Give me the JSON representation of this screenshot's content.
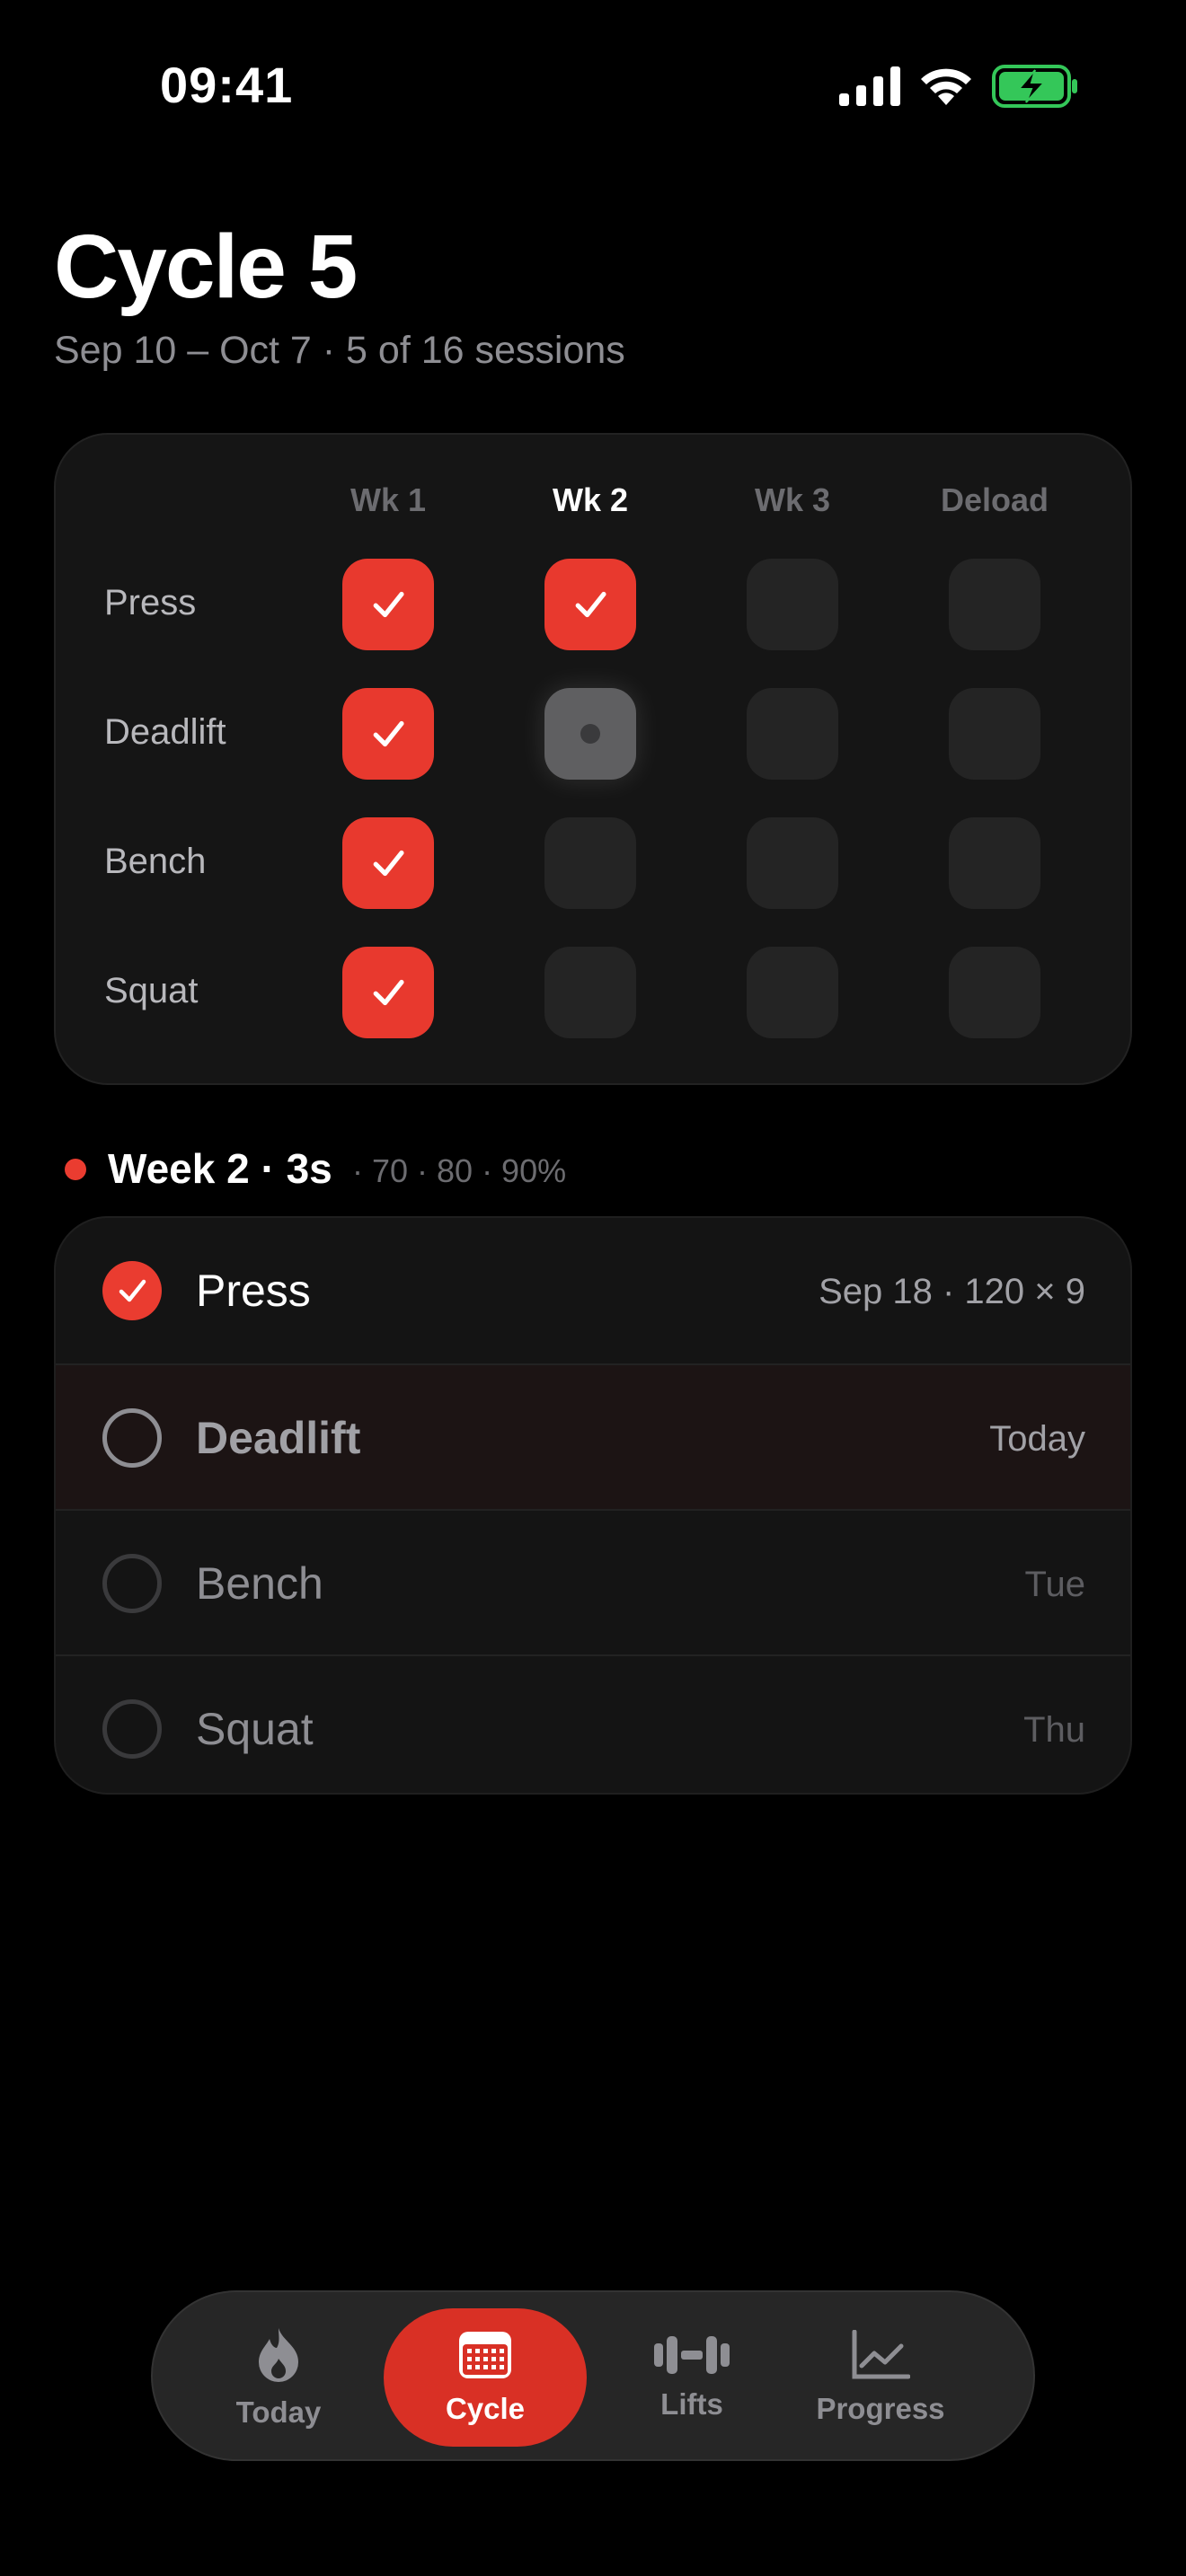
{
  "status_bar": {
    "time": "09:41"
  },
  "header": {
    "title": "Cycle 5",
    "subtitle": "Sep 10 – Oct 7 · 5 of 16 sessions"
  },
  "grid": {
    "columns": [
      "Wk 1",
      "Wk 2",
      "Wk 3",
      "Deload"
    ],
    "current_column": 1,
    "rows": [
      {
        "label": "Press",
        "cells": [
          "done",
          "done",
          "empty",
          "empty"
        ]
      },
      {
        "label": "Deadlift",
        "cells": [
          "done",
          "current",
          "empty",
          "empty"
        ]
      },
      {
        "label": "Bench",
        "cells": [
          "done",
          "empty",
          "empty",
          "empty"
        ]
      },
      {
        "label": "Squat",
        "cells": [
          "done",
          "empty",
          "empty",
          "empty"
        ]
      }
    ]
  },
  "week": {
    "title": "Week 2 · 3s",
    "percentages": "· 70 · 80 · 90%"
  },
  "sessions": [
    {
      "name": "Press",
      "meta": "Sep 18 · 120 × 9",
      "state": "done"
    },
    {
      "name": "Deadlift",
      "meta": "Today",
      "state": "active"
    },
    {
      "name": "Bench",
      "meta": "Tue",
      "state": "pending"
    },
    {
      "name": "Squat",
      "meta": "Thu",
      "state": "pending"
    }
  ],
  "tabs": [
    {
      "label": "Today",
      "icon": "flame-icon",
      "active": false
    },
    {
      "label": "Cycle",
      "icon": "calendar-icon",
      "active": true
    },
    {
      "label": "Lifts",
      "icon": "dumbbell-icon",
      "active": false
    },
    {
      "label": "Progress",
      "icon": "chart-icon",
      "active": false
    }
  ],
  "colors": {
    "accent": "#e8392e",
    "background": "#000000",
    "card": "#151515",
    "battery": "#34c759"
  }
}
